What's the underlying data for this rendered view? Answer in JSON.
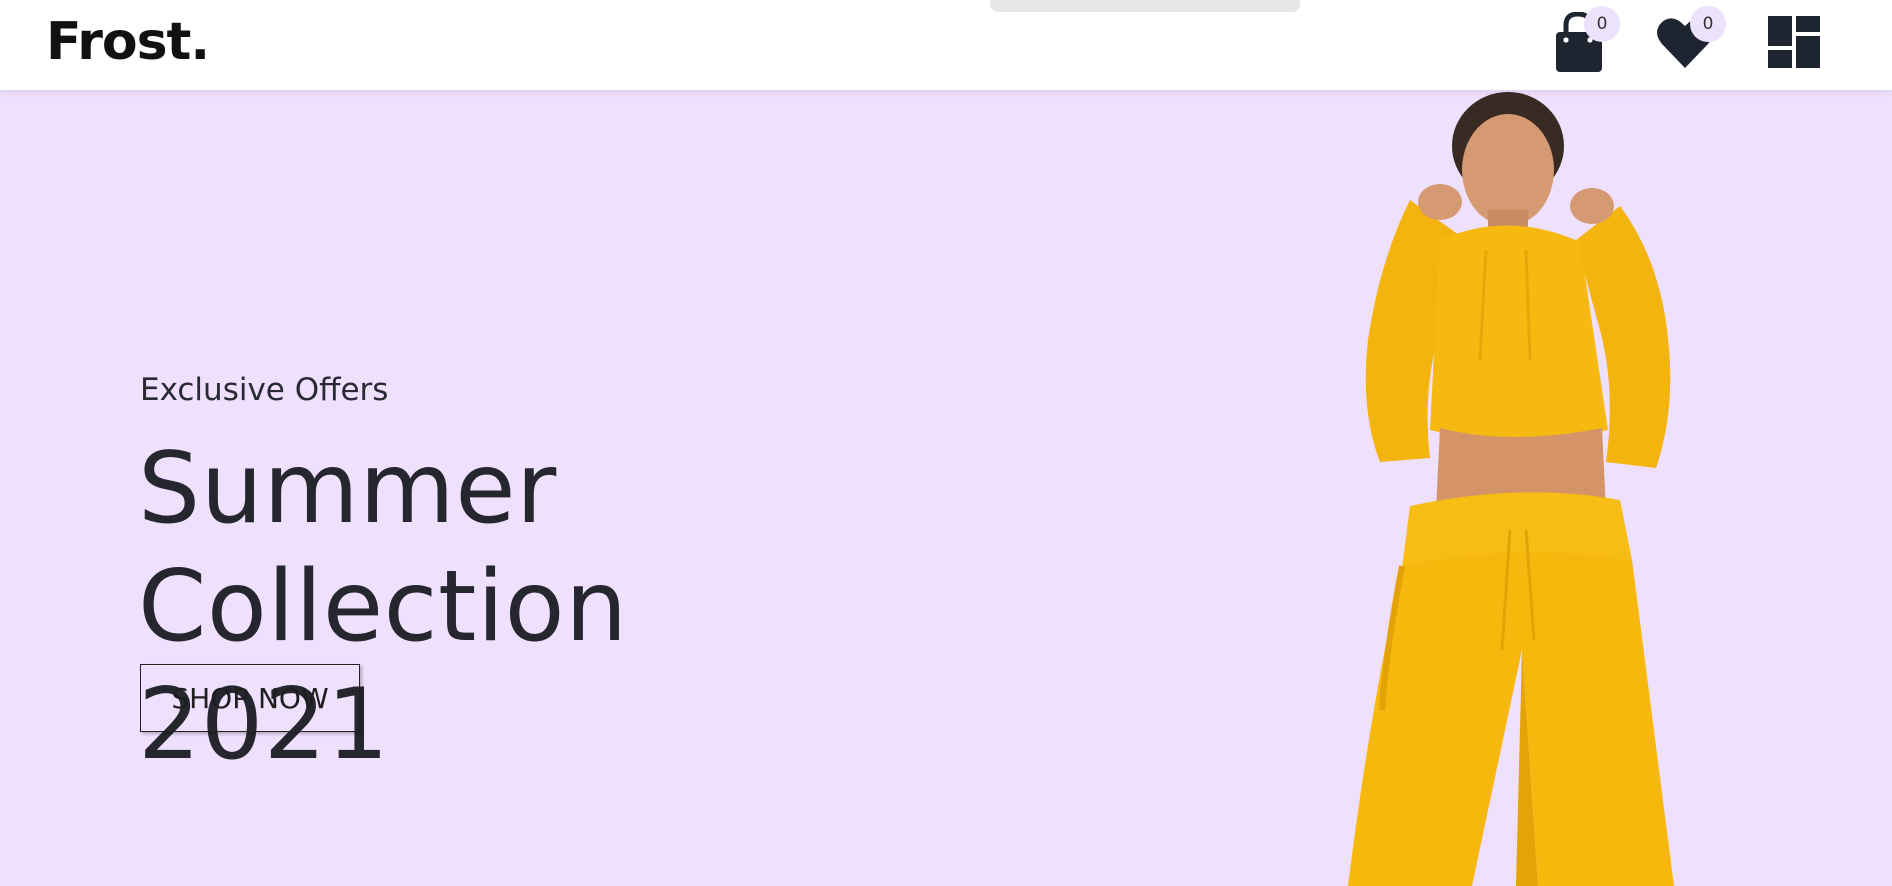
{
  "header": {
    "logo": "Frost.",
    "cart": {
      "icon": "shopping-bag-icon",
      "count": "0"
    },
    "wishlist": {
      "icon": "heart-icon",
      "count": "0"
    },
    "menu": {
      "icon": "dashboard-grid-icon"
    }
  },
  "hero": {
    "eyebrow": "Exclusive Offers",
    "headline_line1": "Summer Collection",
    "headline_line2": "2021",
    "cta_label": "SHOP NOW",
    "image": "model-in-yellow-tracksuit"
  },
  "colors": {
    "background": "#efe0fd",
    "header": "#ffffff",
    "text": "#26262f",
    "badge": "#ece2fb",
    "outfit": "#f7b80d"
  }
}
